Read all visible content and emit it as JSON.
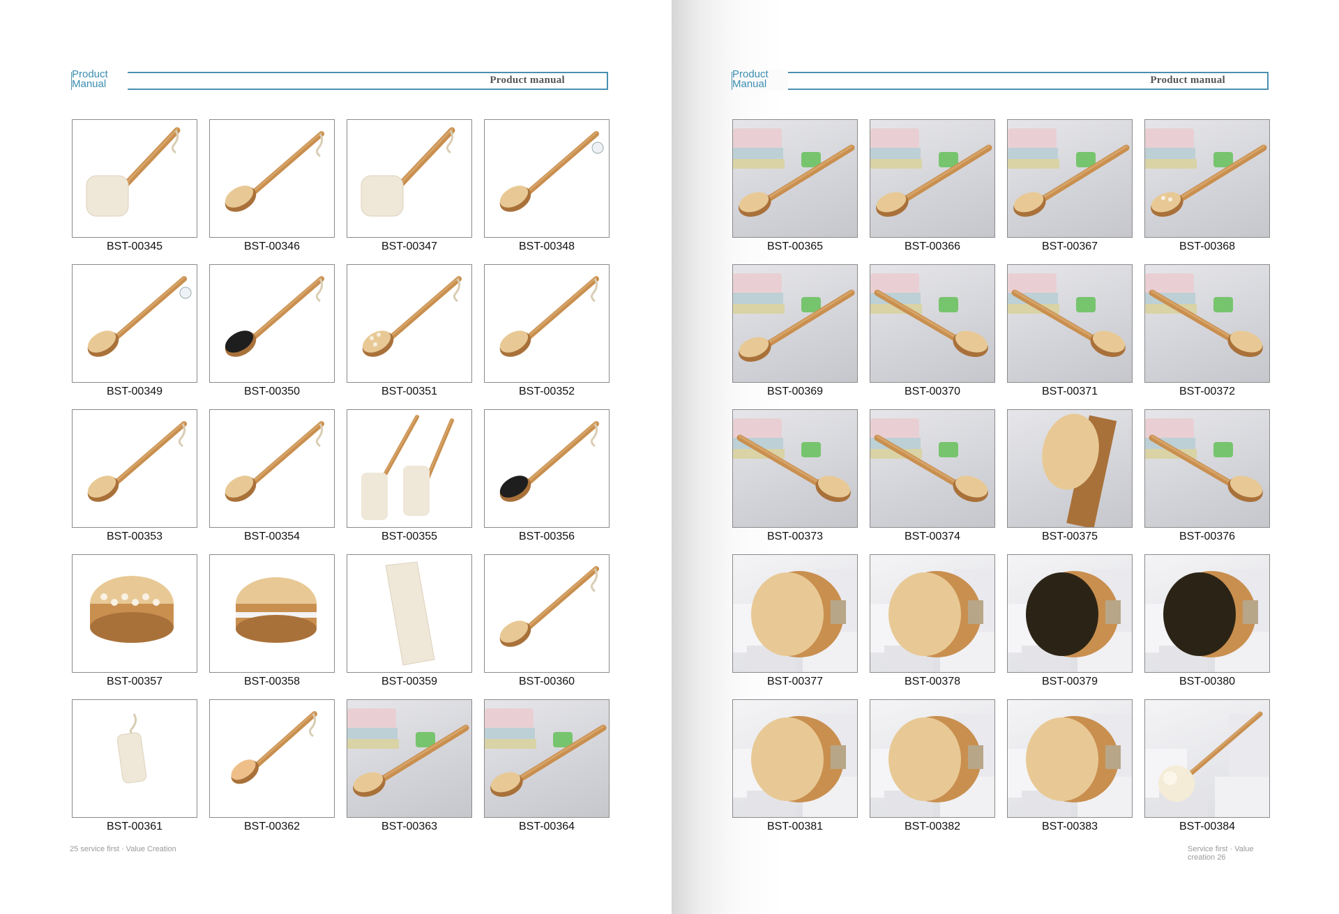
{
  "left_page": {
    "brand": "Product Manual",
    "title": "Product manual",
    "footer": "25 service first · Value Creation",
    "products": [
      {
        "code": "BST-00345",
        "style": "loofah-stick",
        "bg": "white"
      },
      {
        "code": "BST-00346",
        "style": "long-brush",
        "bg": "white"
      },
      {
        "code": "BST-00347",
        "style": "loofah-stick",
        "bg": "white"
      },
      {
        "code": "BST-00348",
        "style": "long-brush-tag",
        "bg": "white"
      },
      {
        "code": "BST-00349",
        "style": "long-brush-tag",
        "bg": "white"
      },
      {
        "code": "BST-00350",
        "style": "long-brush-dark",
        "bg": "white"
      },
      {
        "code": "BST-00351",
        "style": "long-brush-nodes",
        "bg": "white"
      },
      {
        "code": "BST-00352",
        "style": "long-brush",
        "bg": "white"
      },
      {
        "code": "BST-00353",
        "style": "long-brush",
        "bg": "white"
      },
      {
        "code": "BST-00354",
        "style": "long-brush",
        "bg": "white"
      },
      {
        "code": "BST-00355",
        "style": "double-loofah",
        "bg": "white"
      },
      {
        "code": "BST-00356",
        "style": "long-brush-dark",
        "bg": "white"
      },
      {
        "code": "BST-00357",
        "style": "round-nodes",
        "bg": "white"
      },
      {
        "code": "BST-00358",
        "style": "round-brush",
        "bg": "white"
      },
      {
        "code": "BST-00359",
        "style": "loofah-pad",
        "bg": "white"
      },
      {
        "code": "BST-00360",
        "style": "long-brush",
        "bg": "white"
      },
      {
        "code": "BST-00361",
        "style": "loofah-small",
        "bg": "white"
      },
      {
        "code": "BST-00362",
        "style": "long-brush-pink",
        "bg": "white"
      },
      {
        "code": "BST-00363",
        "style": "scene-brush",
        "bg": "studio"
      },
      {
        "code": "BST-00364",
        "style": "scene-brush",
        "bg": "studio"
      }
    ]
  },
  "right_page": {
    "brand": "Product Manual",
    "title": "Product manual",
    "footer": "Service first · Value creation 26",
    "products": [
      {
        "code": "BST-00365",
        "style": "scene-brush",
        "bg": "studio"
      },
      {
        "code": "BST-00366",
        "style": "scene-brush",
        "bg": "studio"
      },
      {
        "code": "BST-00367",
        "style": "scene-brush",
        "bg": "studio"
      },
      {
        "code": "BST-00368",
        "style": "scene-brush-nodes",
        "bg": "studio"
      },
      {
        "code": "BST-00369",
        "style": "scene-brush",
        "bg": "studio"
      },
      {
        "code": "BST-00370",
        "style": "scene-brush-right",
        "bg": "studio"
      },
      {
        "code": "BST-00371",
        "style": "scene-brush-right",
        "bg": "studio"
      },
      {
        "code": "BST-00372",
        "style": "scene-brush-right",
        "bg": "studio"
      },
      {
        "code": "BST-00373",
        "style": "scene-brush-right",
        "bg": "studio"
      },
      {
        "code": "BST-00374",
        "style": "scene-brush-right",
        "bg": "studio"
      },
      {
        "code": "BST-00375",
        "style": "closeup-brush",
        "bg": "studio"
      },
      {
        "code": "BST-00376",
        "style": "scene-brush-right",
        "bg": "studio"
      },
      {
        "code": "BST-00377",
        "style": "oval-light",
        "bg": "cube"
      },
      {
        "code": "BST-00378",
        "style": "oval-light",
        "bg": "cube"
      },
      {
        "code": "BST-00379",
        "style": "oval-dark",
        "bg": "cube"
      },
      {
        "code": "BST-00380",
        "style": "oval-dark",
        "bg": "cube"
      },
      {
        "code": "BST-00381",
        "style": "oval-light",
        "bg": "cube"
      },
      {
        "code": "BST-00382",
        "style": "oval-light",
        "bg": "cube"
      },
      {
        "code": "BST-00383",
        "style": "oval-light",
        "bg": "cube"
      },
      {
        "code": "BST-00384",
        "style": "pouf-stick",
        "bg": "cube"
      }
    ]
  },
  "colors": {
    "header_border": "#4a8fb0",
    "brand_text": "#3a8db0",
    "wood": "#c98f4f",
    "wood_dark": "#a9713a",
    "bristle_light": "#e8c995",
    "bristle_dark": "#1e1e1e",
    "loofah": "#efe7d8"
  }
}
